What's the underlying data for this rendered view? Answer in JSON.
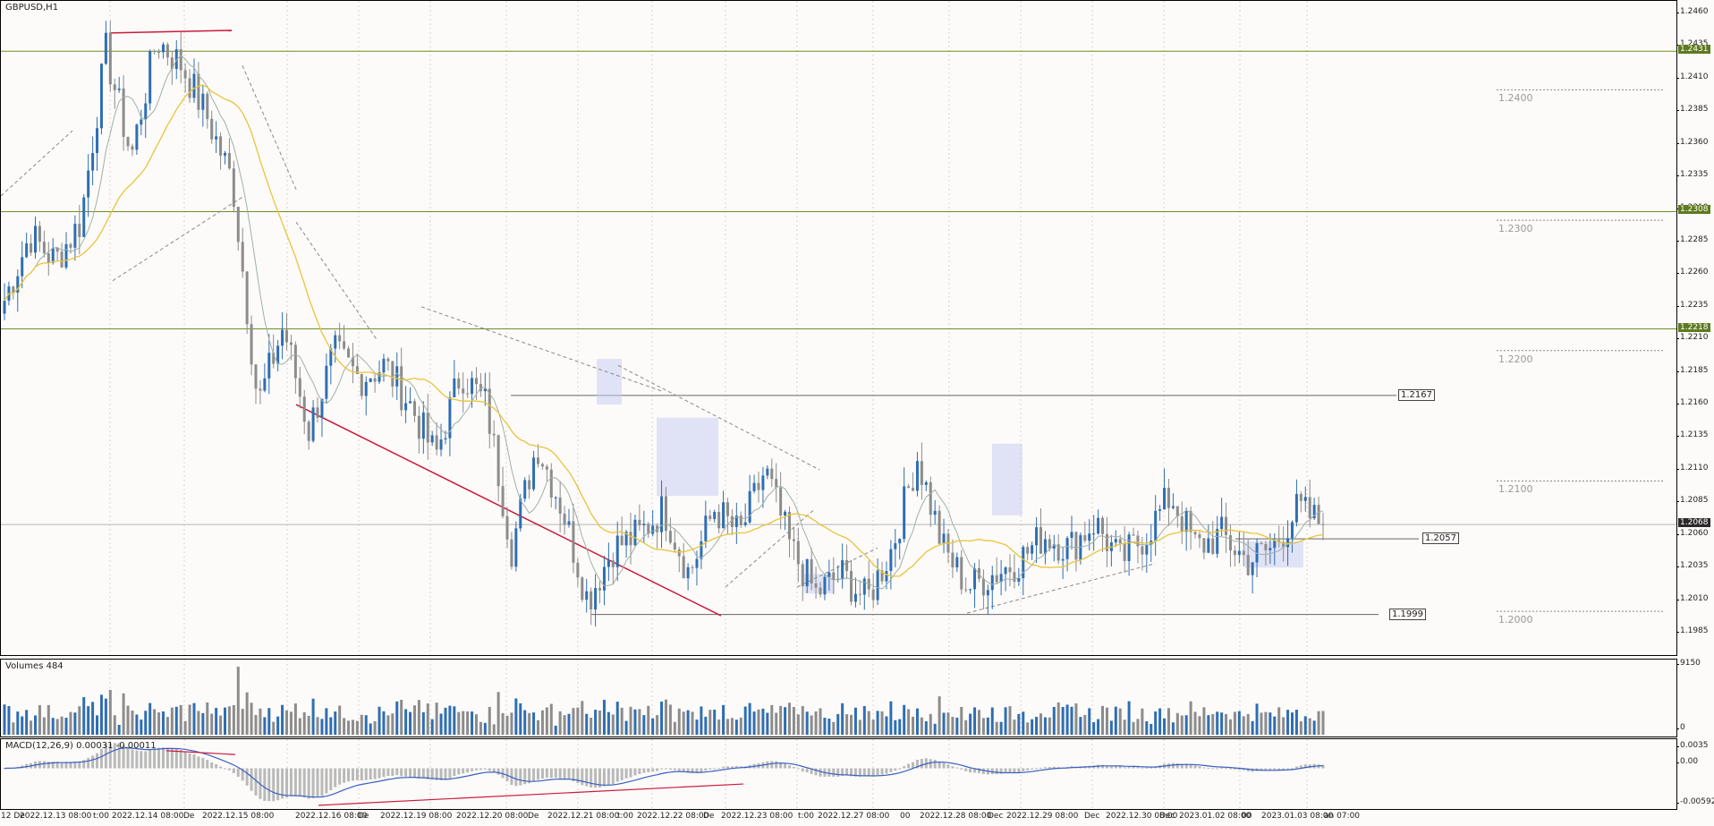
{
  "main": {
    "title": "GBPUSD,H1",
    "price_ticks": [
      "1.2460",
      "1.2435",
      "1.2410",
      "1.2385",
      "1.2360",
      "1.2335",
      "1.2310",
      "1.2285",
      "1.2260",
      "1.2235",
      "1.2210",
      "1.2185",
      "1.2160",
      "1.2135",
      "1.2110",
      "1.2085",
      "1.2060",
      "1.2035",
      "1.2010",
      "1.1985"
    ],
    "h_levels": [
      "1.2431",
      "1.2308",
      "1.2218"
    ],
    "current_price": "1.2068",
    "round_levels": [
      "1.2400",
      "1.2300",
      "1.2200",
      "1.2100",
      "1.2000"
    ],
    "box_labels": [
      "1.2167",
      "1.2057",
      "1.1999"
    ]
  },
  "volumes": {
    "title": "Volumes 484",
    "ticks": [
      "9150",
      "0"
    ]
  },
  "macd": {
    "title": "MACD(12,26,9) 0.00031 -0.00011",
    "ticks": [
      "0.0035",
      "0.00",
      "-0.00592"
    ]
  },
  "time_axis": [
    "12 De",
    "2022.12.13 08:00",
    "t:00",
    "2022.12.14 08:00",
    "De",
    "2022.12.15 08:00",
    "2022.12.16 08:00",
    "De",
    "2022.12.19 08:00",
    "2022.12.20 08:00",
    "De",
    "2022.12.21 08:00",
    "t:00",
    "2022.12.22 08:00",
    "De",
    "2022.12.23 08:00",
    "t:00",
    "2022.12.27 08:00",
    "00",
    "2022.12.28 08:00",
    "Dec",
    "2022.12.29 08:00",
    "Dec",
    "2022.12.30 08:00",
    "Dec",
    "2023.01.02 08:00",
    "00",
    "2023.01.03 08:00",
    "an 07:00"
  ],
  "colors": {
    "bull": "#2e6eb3",
    "bear": "#8c8c8c",
    "ma_slow": "#e8c43a",
    "ma_fast": "#9fb0a6",
    "hline": "#6f8f2a",
    "divergence": "#cc1a3a",
    "macd_line": "#3a5fc4"
  },
  "chart_data": {
    "type": "candlestick",
    "symbol": "GBPUSD",
    "timeframe": "H1",
    "ylim": [
      1.1985,
      1.246
    ],
    "series_anchor_close": [
      1.224,
      1.229,
      1.227,
      1.23,
      1.2431,
      1.235,
      1.244,
      1.242,
      1.238,
      1.233,
      1.216,
      1.222,
      1.214,
      1.22,
      1.218,
      1.219,
      1.216,
      1.212,
      1.2185,
      1.216,
      1.205,
      1.213,
      1.208,
      1.201,
      1.205,
      1.206,
      1.208,
      1.203,
      1.208,
      1.206,
      1.211,
      1.205,
      1.2015,
      1.203,
      1.201,
      1.205,
      1.212,
      1.205,
      1.202,
      1.203,
      1.204,
      1.206,
      1.205,
      1.207,
      1.204,
      1.206,
      1.209,
      1.205,
      1.206,
      1.204,
      1.205,
      1.208,
      1.2068
    ],
    "current": 1.2068,
    "horizontal_levels": [
      1.2431,
      1.2308,
      1.2218
    ],
    "round_levels": [
      1.24,
      1.23,
      1.22,
      1.21,
      1.2
    ],
    "boxes": [
      1.2167,
      1.2057,
      1.1999
    ],
    "volume_max": 9150,
    "macd": {
      "params": "12,26,9",
      "main": 0.00031,
      "signal": -0.00011,
      "ylim": [
        -0.00592,
        0.0035
      ]
    }
  }
}
